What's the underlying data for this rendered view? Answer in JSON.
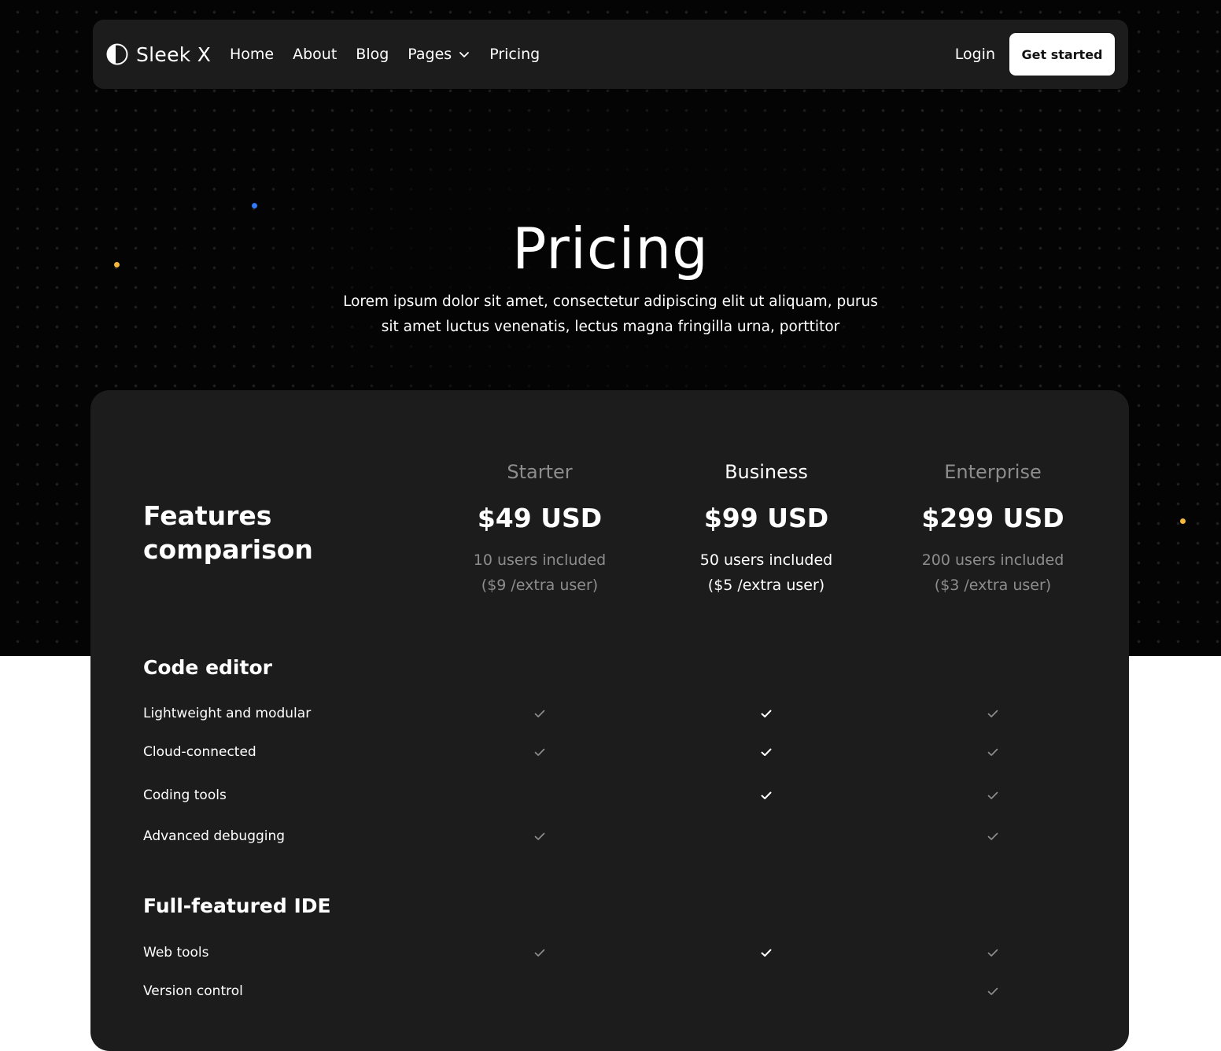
{
  "brand": {
    "name": "Sleek X",
    "logo_icon": "half-circle-logo-icon"
  },
  "nav": {
    "links": [
      "Home",
      "About",
      "Blog",
      "Pages",
      "Pricing"
    ],
    "login": "Login",
    "cta": "Get started"
  },
  "hero": {
    "title": "Pricing",
    "subtitle": "Lorem ipsum dolor sit amet, consectetur adipiscing elit ut aliquam, purus sit amet luctus venenatis, lectus magna fringilla urna, porttitor"
  },
  "comparison": {
    "heading": "Features comparison",
    "plans": [
      {
        "name": "Starter",
        "price": "$49 USD",
        "users": "10 users included",
        "extra": "($9 /extra user)",
        "highlighted": false
      },
      {
        "name": "Business",
        "price": "$99 USD",
        "users": "50 users included",
        "extra": "($5 /extra user)",
        "highlighted": true
      },
      {
        "name": "Enterprise",
        "price": "$299 USD",
        "users": "200 users included",
        "extra": "($3 /extra user)",
        "highlighted": false
      }
    ],
    "sections": [
      {
        "title": "Code editor",
        "features": [
          {
            "label": "Lightweight and modular",
            "starter": true,
            "business": true,
            "enterprise": true
          },
          {
            "label": "Cloud-connected",
            "starter": true,
            "business": true,
            "enterprise": true
          },
          {
            "label": "Coding tools",
            "starter": false,
            "business": true,
            "enterprise": true
          },
          {
            "label": "Advanced debugging",
            "starter": true,
            "business": false,
            "enterprise": true
          }
        ]
      },
      {
        "title": "Full-featured IDE",
        "features": [
          {
            "label": "Web tools",
            "starter": true,
            "business": true,
            "enterprise": true
          },
          {
            "label": "Version control",
            "starter": false,
            "business": false,
            "enterprise": true
          }
        ]
      }
    ]
  },
  "colors": {
    "hero_background": "#040404",
    "card_background": "#1c1c1c",
    "accent_blue": "#2f7cf6",
    "accent_yellow": "#f5b83d",
    "muted_text": "#8d8d8d"
  }
}
